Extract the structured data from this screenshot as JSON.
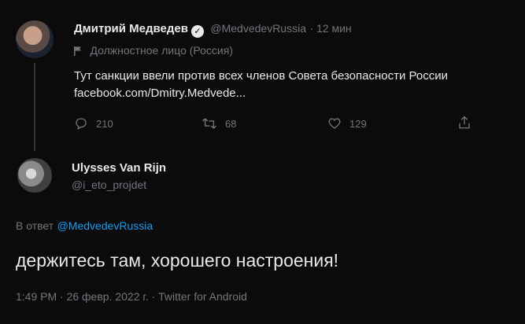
{
  "tweet": {
    "author_name": "Дмитрий Медведев",
    "handle": "@MedvedevRussia",
    "time": "12 мин",
    "official_label": "Должностное лицо (Россия)",
    "text": "Тут санкции ввели против всех членов Совета безопасности России",
    "link_text": "facebook.com/Dmitry.Medvede...",
    "stats": {
      "replies": "210",
      "retweets": "68",
      "likes": "129"
    }
  },
  "reply": {
    "author_name": "Ulysses Van Rijn",
    "handle": "@i_eto_projdet",
    "replying_prefix": "В ответ",
    "replying_to": "@MedvedevRussia",
    "text": "держитесь там, хорошего настроения!",
    "meta": "1:49 PM · 26 февр. 2022 г. · Twitter for Android"
  },
  "icons": {
    "verified": "verified-badge-icon",
    "official": "flag-icon",
    "reply": "reply-icon",
    "retweet": "retweet-icon",
    "like": "heart-icon",
    "share": "share-icon"
  }
}
